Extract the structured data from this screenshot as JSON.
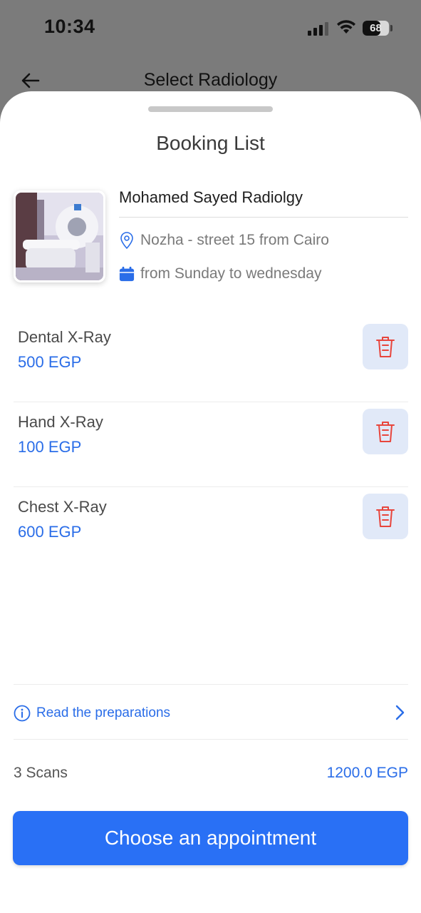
{
  "status_bar": {
    "time": "10:34",
    "battery": "68",
    "battery_level": 0.68
  },
  "background_screen": {
    "title": "Select Radiology"
  },
  "sheet": {
    "title": "Booking List",
    "center": {
      "name": "Mohamed Sayed Radiolgy",
      "address": "Nozha - street 15 from Cairo",
      "schedule": "from Sunday to wednesday"
    },
    "scans": [
      {
        "name": "Dental X-Ray",
        "price": "500 EGP"
      },
      {
        "name": "Hand X-Ray",
        "price": "100 EGP"
      },
      {
        "name": "Chest X-Ray",
        "price": "600 EGP"
      }
    ],
    "preparations_link": "Read the preparations",
    "summary": {
      "count": "3 Scans",
      "total": "1200.0 EGP"
    },
    "cta_label": "Choose an appointment"
  },
  "icons": {
    "back": "arrow-left-icon",
    "location": "map-pin-icon",
    "calendar": "calendar-icon",
    "delete": "trash-icon",
    "info": "info-circle-icon",
    "chevron": "chevron-right-icon"
  },
  "colors": {
    "accent": "#2970f5",
    "danger": "#e8453c",
    "delete_bg": "#e1e9f8"
  }
}
